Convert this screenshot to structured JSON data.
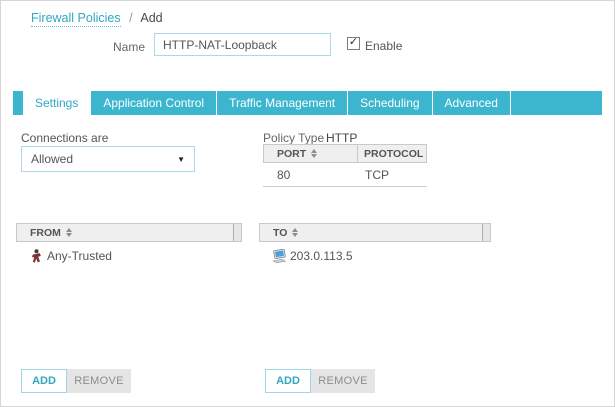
{
  "breadcrumb": {
    "link": "Firewall Policies",
    "separator": "/",
    "current": "Add"
  },
  "name_field": {
    "label": "Name",
    "value": "HTTP-NAT-Loopback",
    "enabled": true,
    "checkbox_glyph": "✓",
    "enable_label": "Enable"
  },
  "tabs": {
    "items": [
      {
        "label": "Settings",
        "active": true
      },
      {
        "label": "Application Control",
        "active": false
      },
      {
        "label": "Traffic Management",
        "active": false
      },
      {
        "label": "Scheduling",
        "active": false
      },
      {
        "label": "Advanced",
        "active": false
      }
    ]
  },
  "connections": {
    "label": "Connections are",
    "selected": "Allowed",
    "arrow_glyph": "▼"
  },
  "policy_type": {
    "label": "Policy Type",
    "value": "HTTP"
  },
  "port_table": {
    "headers": {
      "port": "PORT",
      "protocol": "PROTOCOL"
    },
    "rows": [
      {
        "port": "80",
        "protocol": "TCP"
      }
    ]
  },
  "from_section": {
    "header": "FROM",
    "rows": [
      {
        "label": "Any-Trusted",
        "icon": "alias-person-icon"
      }
    ],
    "add_label": "ADD",
    "remove_label": "REMOVE"
  },
  "to_section": {
    "header": "TO",
    "rows": [
      {
        "label": "203.0.113.5",
        "icon": "host-computer-icon"
      }
    ],
    "add_label": "ADD",
    "remove_label": "REMOVE"
  },
  "icons": {
    "sort": "up-down-sort-triangles",
    "dropdown": "down-triangle",
    "from_row": "alias-person-icon",
    "to_row": "host-computer-icon"
  },
  "colors": {
    "tab_teal": "#3cb6ce",
    "link_teal": "#2fa7c1",
    "field_border": "#a9dae6",
    "table_header_bg": "#efefef",
    "remove_button_bg": "#e5e5e5",
    "page_border": "#d5d5d5"
  }
}
